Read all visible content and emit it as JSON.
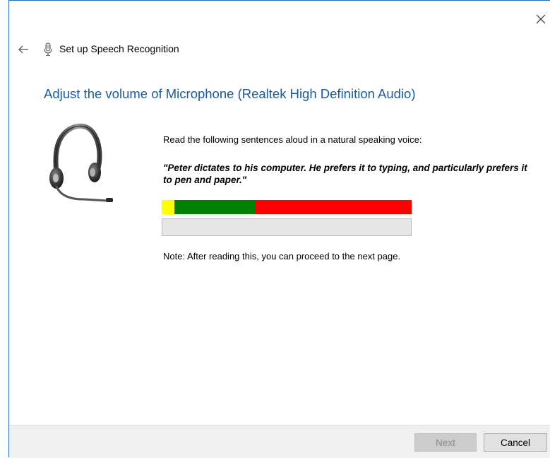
{
  "window": {
    "title": "Set up Speech Recognition",
    "close_glyph": "✕",
    "back_glyph": "←"
  },
  "page": {
    "heading": "Adjust the volume of Microphone (Realtek High Definition Audio)",
    "instruction": "Read the following sentences aloud in a natural speaking voice:",
    "quote": "\"Peter dictates to his computer. He prefers it to typing, and particularly prefers it to pen and paper.\"",
    "note": "Note: After reading this, you can proceed to the next page."
  },
  "level_meter": {
    "segments": [
      {
        "color": "#ffff00",
        "fraction": 0.05
      },
      {
        "color": "#008000",
        "fraction": 0.325
      },
      {
        "color": "#ff0000",
        "fraction": 0.625
      }
    ]
  },
  "reading_progress": {
    "fraction": 0.0
  },
  "footer": {
    "next_label": "Next",
    "next_enabled": false,
    "cancel_label": "Cancel"
  },
  "colors": {
    "heading": "#1a5aa6",
    "window_border": "#1f6fc5"
  },
  "icons": {
    "back": "back-arrow-icon",
    "close": "close-icon",
    "title_icon": "microphone-icon",
    "illustration": "headset-icon"
  }
}
